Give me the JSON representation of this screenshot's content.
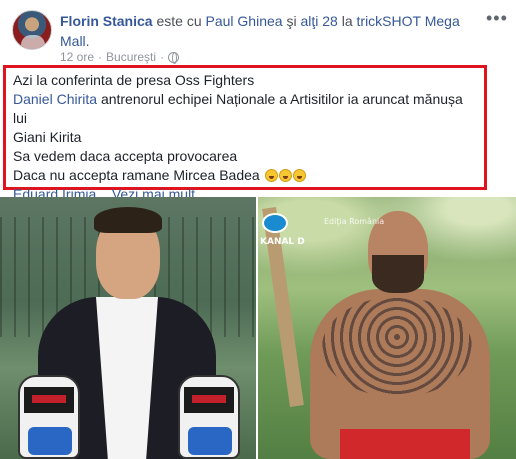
{
  "post": {
    "author": "Florin Stanica",
    "with_prefix": "este cu",
    "tagged": "Paul Ghinea",
    "and_others_prefix": "şi",
    "others": "alţi 28",
    "at_prefix": "la",
    "location": "trickSHOT Mega Mall",
    "location_suffix": ".",
    "time": "12 ore",
    "separator": "·",
    "city": "Bucureşti",
    "privacy_icon": "globe-icon",
    "more_icon": "more-options-icon",
    "more_glyph": "•••"
  },
  "text": {
    "line1": "Azi la conferinta de presa Oss Fighters",
    "mention1": "Daniel Chirita",
    "line2_rest": "antrenorul echipei Naționale a Artisitilor ia aruncat mănușa lui",
    "line3": "Giani Kirita",
    "line4": "Sa vedem daca accepta provocarea",
    "line5": "Daca nu accepta ramane Mircea Badea",
    "emoji_icon": "laughing-emoji-icon",
    "mention2": "Eduard Irimia...",
    "see_more": "Vezi mai mult"
  },
  "photos": {
    "right_watermark": "KANAL D",
    "right_corner_text": "Ediţia România"
  },
  "colors": {
    "link": "#365899",
    "highlight_border": "#e0141e",
    "meta": "#90949c"
  }
}
